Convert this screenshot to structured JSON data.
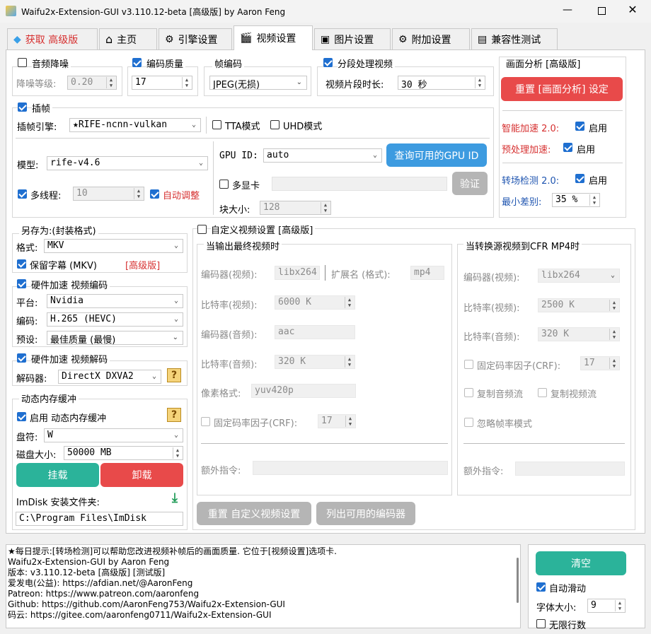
{
  "window": {
    "title": "Waifu2x-Extension-GUI v3.110.12-beta [高级版] by Aaron Feng"
  },
  "tabs": [
    {
      "label": "获取  高级版"
    },
    {
      "label": "主页"
    },
    {
      "label": "引擎设置"
    },
    {
      "label": "视频设置"
    },
    {
      "label": "图片设置"
    },
    {
      "label": "附加设置"
    },
    {
      "label": "兼容性测试"
    }
  ],
  "denoise": {
    "label": "音频降噪",
    "level_label": "降噪等级:",
    "level_value": "0.20"
  },
  "quality": {
    "label": "编码质量",
    "value": "17"
  },
  "frame_codec": {
    "label": "帧编码",
    "value": "JPEG(无损)"
  },
  "segment": {
    "label": "分段处理视频",
    "duration_label": "视频片段时长:",
    "duration_value": "30 秒"
  },
  "scene": {
    "title": "画面分析 [高级版]",
    "reset_label": "重置 [画面分析] 设定",
    "smart_label": "智能加速 2.0:",
    "smart_enable": "启用",
    "pre_label": "预处理加速:",
    "pre_enable": "启用",
    "scene_label": "转场检测 2.0:",
    "scene_enable": "启用",
    "mindiff_label": "最小差别:",
    "mindiff_value": "35 %"
  },
  "interp": {
    "label": "插帧",
    "engine_label": "插帧引擎:",
    "engine_value": "★RIFE-ncnn-vulkan",
    "tta_label": "TTA模式",
    "uhd_label": "UHD模式",
    "model_label": "模型:",
    "model_value": "rife-v4.6",
    "gpu_label": "GPU ID:",
    "gpu_value": "auto",
    "query_gpu_label": "查询可用的GPU ID",
    "multigpu_label": "多显卡",
    "verify_label": "验证",
    "threads_label": "多线程:",
    "threads_value": "10",
    "auto_adjust_label": "自动调整",
    "block_label": "块大小:",
    "block_value": "128"
  },
  "save_as": {
    "title": "另存为:(封装格式)",
    "format_label": "格式:",
    "format_value": "MKV",
    "keep_sub_label": "保留字幕 (MKV)",
    "premium_tag": "[高级版]"
  },
  "hw_encode": {
    "label": "硬件加速 视频编码",
    "platform_label": "平台:",
    "platform_value": "Nvidia",
    "codec_label": "编码:",
    "codec_value": "H.265 (HEVC)",
    "preset_label": "预设:",
    "preset_value": "最佳质量 (最慢)"
  },
  "hw_decode": {
    "label": "硬件加速 视频解码",
    "decoder_label": "解码器:",
    "decoder_value": "DirectX DXVA2",
    "help": "?"
  },
  "ramdisk": {
    "title": "动态内存缓冲",
    "enable_label": "启用 动态内存缓冲",
    "help": "?",
    "drive_label": "盘符:",
    "drive_value": "W",
    "size_label": "磁盘大小:",
    "size_value": "50000 MB",
    "mount_label": "挂载",
    "unmount_label": "卸载",
    "imdisk_label": "ImDisk 安装文件夹:",
    "imdisk_path": "C:\\Program Files\\ImDisk"
  },
  "custom": {
    "label": "自定义视频设置 [高级版]",
    "out_title": "当输出最终视频时",
    "cfr_title": "当转换源视频到CFR MP4时",
    "vcodec_label": "编码器(视频):",
    "vcodec_value": "libx264",
    "ext_label": "扩展名 (格式):",
    "ext_value": "mp4",
    "vbitrate_label": "比特率(视频):",
    "vbitrate_value": "6000 K",
    "acodec_label": "编码器(音频):",
    "acodec_value": "aac",
    "abitrate_label": "比特率(音频):",
    "abitrate_value": "320 K",
    "pixfmt_label": "像素格式:",
    "pixfmt_value": "yuv420p",
    "crf_label": "固定码率因子(CRF):",
    "crf_value": "17",
    "extra_label": "额外指令:",
    "cfr_vcodec_value": "libx264",
    "cfr_vbitrate_value": "2500 K",
    "cfr_abitrate_value": "320 K",
    "cfr_crf_value": "17",
    "copy_audio_label": "复制音频流",
    "copy_video_label": "复制视频流",
    "ignore_fps_label": "忽略帧率模式",
    "reset_label": "重置 自定义视频设置",
    "list_codecs_label": "列出可用的编码器"
  },
  "log": {
    "lines": [
      "★每日提示:[转场检测]可以帮助您改进视频补帧后的画面质量. 它位于[视频设置]选项卡.",
      "Waifu2x-Extension-GUI by Aaron Feng",
      "版本: v3.110.12-beta [高级版] [测试版]",
      "爱发电(公益): https://afdian.net/@AaronFeng",
      "Patreon: https://www.patreon.com/aaronfeng",
      "Github: https://github.com/AaronFeng753/Waifu2x-Extension-GUI",
      "码云: https://gitee.com/aaronfeng0711/Waifu2x-Extension-GUI"
    ]
  },
  "log_controls": {
    "clear_label": "清空",
    "autoscroll_label": "自动滑动",
    "fontsize_label": "字体大小:",
    "fontsize_value": "9",
    "unlimited_label": "无限行数"
  },
  "colors": {
    "teal": "#2bb39a",
    "red": "#e84a4a",
    "blue": "#3d9be0",
    "gray_btn": "#b5b5b5",
    "check_blue": "#1f6fd0"
  }
}
